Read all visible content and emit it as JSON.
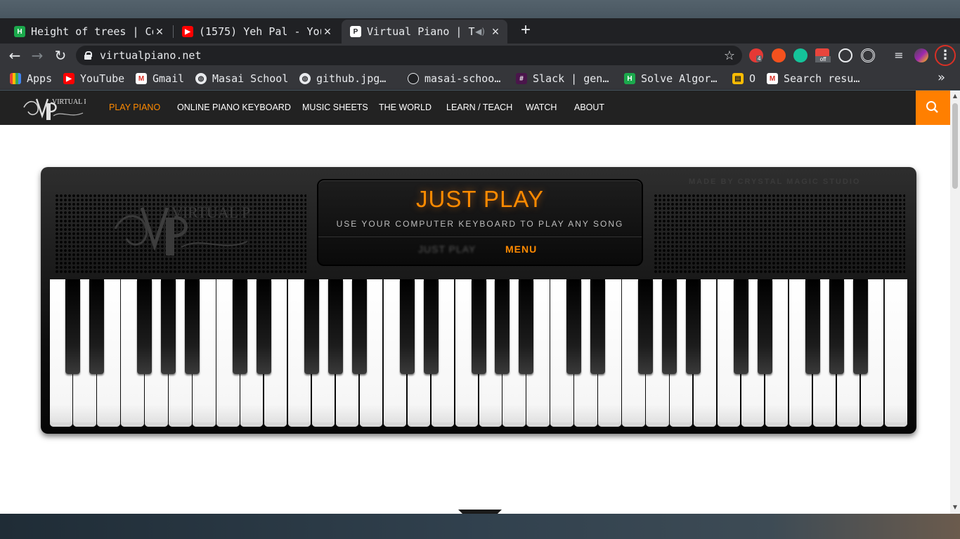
{
  "browser": {
    "tabs": [
      {
        "title": "Height of trees | Co",
        "favicon": "hackerrank-icon",
        "color": "#1ba94c",
        "active": false
      },
      {
        "title": "(1575) Yeh Pal - You",
        "favicon": "youtube-icon",
        "color": "#ff0000",
        "active": false
      },
      {
        "title": "Virtual Piano | T",
        "favicon": "virtualpiano-icon",
        "color": "#ffffff",
        "active": true
      }
    ],
    "new_tab": "+",
    "url": "virtualpiano.net",
    "bookmarks": [
      {
        "label": "Apps",
        "icon": "apps-grid-icon"
      },
      {
        "label": "YouTube",
        "icon": "youtube-icon"
      },
      {
        "label": "Gmail",
        "icon": "gmail-icon"
      },
      {
        "label": "Masai School",
        "icon": "globe-icon"
      },
      {
        "label": "github.jpg…",
        "icon": "globe-icon"
      },
      {
        "label": "masai-schoo…",
        "icon": "github-icon"
      },
      {
        "label": "Slack | gen…",
        "icon": "slack-icon"
      },
      {
        "label": "Solve Algor…",
        "icon": "hackerrank-icon"
      },
      {
        "label": "O",
        "icon": "bookmark-icon"
      },
      {
        "label": "Search resu…",
        "icon": "gmail-icon"
      }
    ],
    "extension_badges": {
      "first": "4",
      "off": "off"
    }
  },
  "site": {
    "logo_text": "VIRTUAL PIANO",
    "nav": [
      "PLAY PIANO",
      "ONLINE PIANO KEYBOARD",
      "MUSIC SHEETS",
      "THE WORLD",
      "LEARN / TEACH",
      "WATCH",
      "ABOUT"
    ],
    "accent": "#ff8a00",
    "made_by": "MADE BY CRYSTAL MAGIC STUDIO",
    "screen": {
      "title": "JUST PLAY",
      "subtitle": "USE YOUR COMPUTER KEYBOARD TO PLAY ANY SONG",
      "tabs": [
        "JUST PLAY",
        "MENU"
      ]
    },
    "white_keys": 36,
    "trophy_icon": "trophy-icon"
  }
}
